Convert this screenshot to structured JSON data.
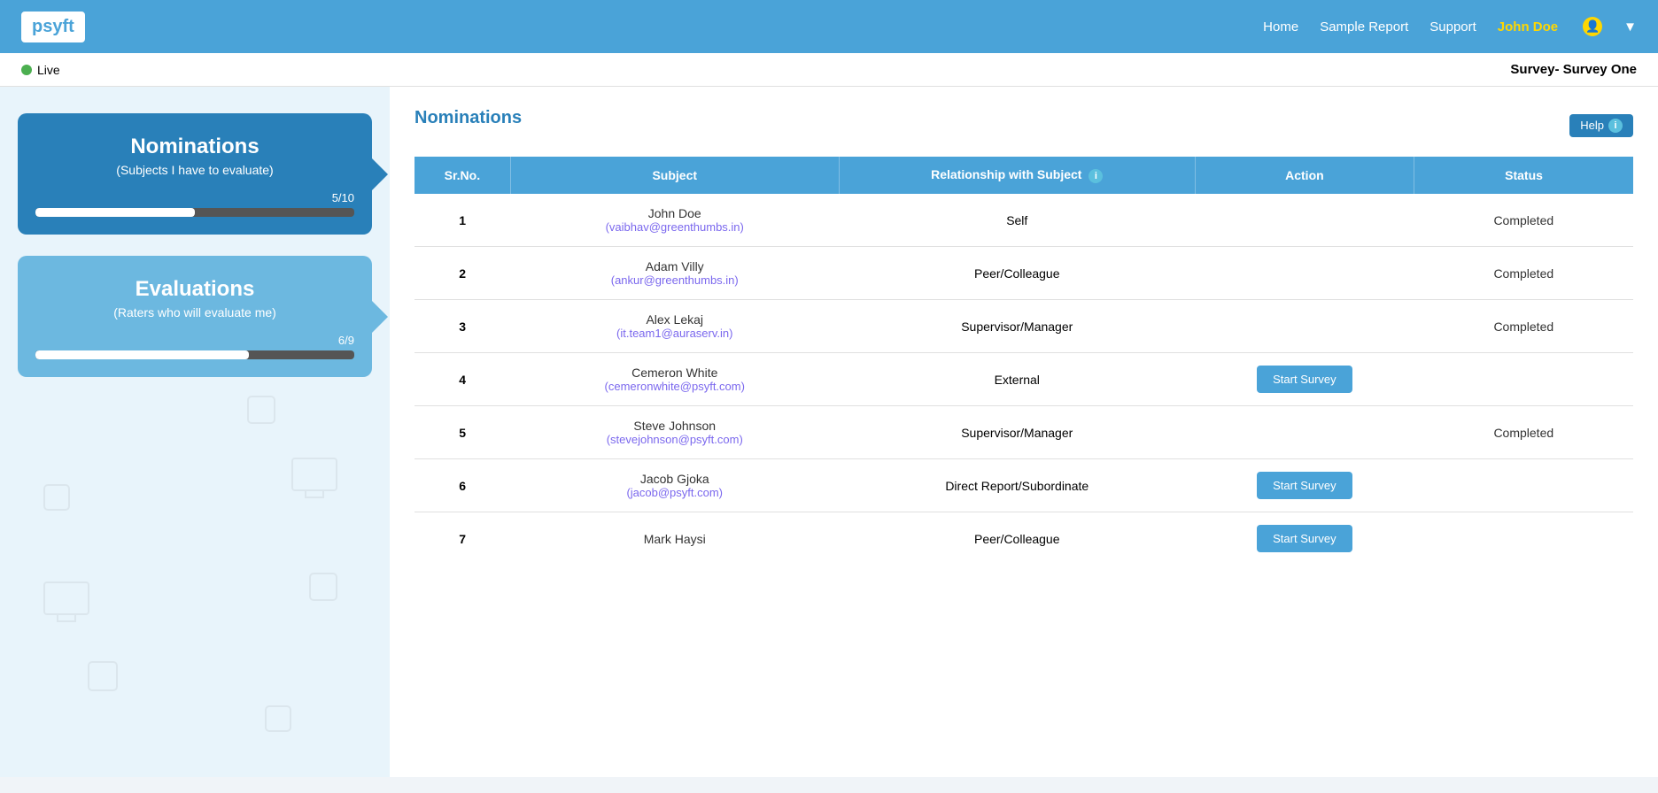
{
  "header": {
    "logo": "psyft",
    "nav": {
      "home": "Home",
      "sample_report": "Sample Report",
      "support": "Support",
      "user_name": "John Doe",
      "dropdown_icon": "▼"
    }
  },
  "sub_header": {
    "live_label": "Live",
    "survey_title": "Survey- Survey One"
  },
  "sidebar": {
    "nominations_card": {
      "title": "Nominations",
      "subtitle": "(Subjects I have to evaluate)",
      "progress_label": "5/10",
      "progress_percent": 50
    },
    "evaluations_card": {
      "title": "Evaluations",
      "subtitle": "(Raters who will evaluate me)",
      "progress_label": "6/9",
      "progress_percent": 67
    }
  },
  "nominations_section": {
    "title": "Nominations",
    "help_button": "Help",
    "table": {
      "headers": [
        "Sr.No.",
        "Subject",
        "Relationship with Subject",
        "Action",
        "Status"
      ],
      "rows": [
        {
          "srno": "1",
          "subject_name": "John Doe",
          "subject_email": "(vaibhav@greenthumbs.in)",
          "relationship": "Self",
          "action": "",
          "status": "Completed"
        },
        {
          "srno": "2",
          "subject_name": "Adam Villy",
          "subject_email": "(ankur@greenthumbs.in)",
          "relationship": "Peer/Colleague",
          "action": "",
          "status": "Completed"
        },
        {
          "srno": "3",
          "subject_name": "Alex Lekaj",
          "subject_email": "(it.team1@auraserv.in)",
          "relationship": "Supervisor/Manager",
          "action": "",
          "status": "Completed"
        },
        {
          "srno": "4",
          "subject_name": "Cemeron White",
          "subject_email": "(cemeronwhite@psyft.com)",
          "relationship": "External",
          "action": "Start Survey",
          "status": ""
        },
        {
          "srno": "5",
          "subject_name": "Steve Johnson",
          "subject_email": "(stevejohnson@psyft.com)",
          "relationship": "Supervisor/Manager",
          "action": "",
          "status": "Completed"
        },
        {
          "srno": "6",
          "subject_name": "Jacob Gjoka",
          "subject_email": "(jacob@psyft.com)",
          "relationship": "Direct Report/Subordinate",
          "action": "Start Survey",
          "status": ""
        },
        {
          "srno": "7",
          "subject_name": "Mark Haysi",
          "subject_email": "",
          "relationship": "Peer/Colleague",
          "action": "Start Survey",
          "status": ""
        }
      ]
    }
  }
}
